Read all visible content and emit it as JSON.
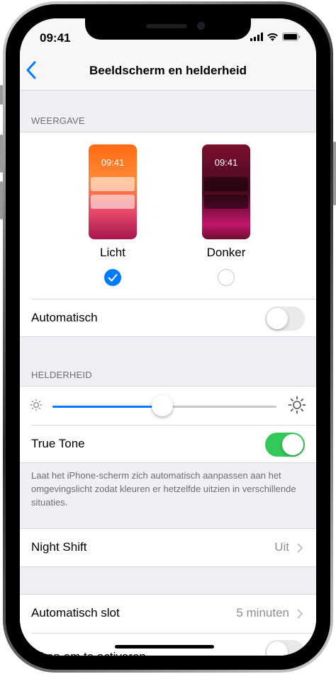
{
  "status_bar": {
    "time": "09:41"
  },
  "nav": {
    "title": "Beeldscherm en helderheid"
  },
  "appearance": {
    "header": "WEERGAVE",
    "options": [
      {
        "label": "Licht",
        "preview_time": "09:41",
        "selected": true
      },
      {
        "label": "Donker",
        "preview_time": "09:41",
        "selected": false
      }
    ],
    "automatic": {
      "label": "Automatisch",
      "on": false
    }
  },
  "brightness": {
    "header": "HELDERHEID",
    "level": 0.49,
    "true_tone": {
      "label": "True Tone",
      "on": true
    },
    "footer": "Laat het iPhone-scherm zich automatisch aanpassen aan het omgevingslicht zodat kleuren er hetzelfde uitzien in verschillende situaties."
  },
  "night_shift": {
    "label": "Night Shift",
    "value": "Uit"
  },
  "auto_lock": {
    "label": "Automatisch slot",
    "value": "5 minuten"
  },
  "raise_to_wake": {
    "label": "Til op om te activeren",
    "on": false
  },
  "colors": {
    "accent": "#007aff",
    "toggle_on": "#34c759",
    "background": "#efeff4"
  }
}
